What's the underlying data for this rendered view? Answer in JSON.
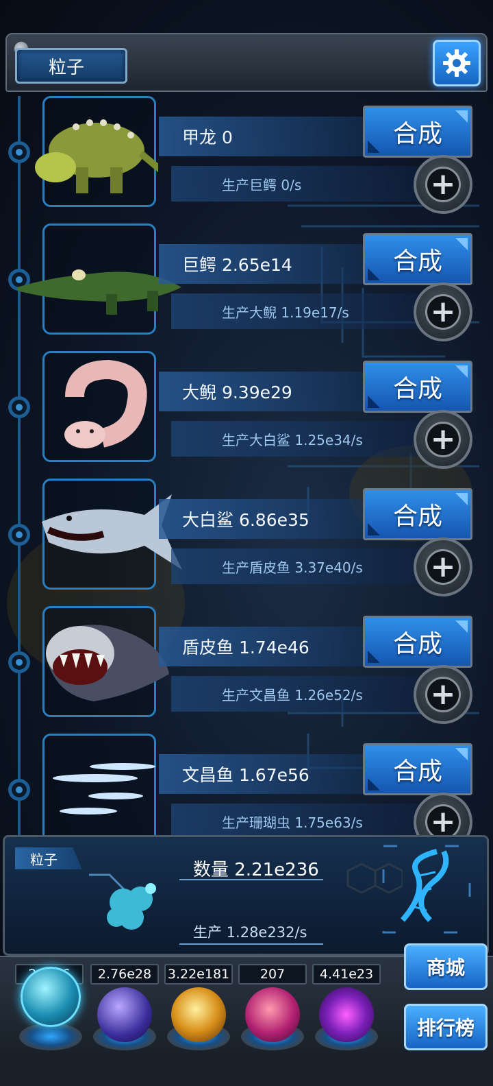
{
  "header": {
    "title": "粒子"
  },
  "creatures": [
    {
      "name": "甲龙 0",
      "production": "生产巨鳄 0/s",
      "combine_label": "合成",
      "icon": "ankylosaurus-icon"
    },
    {
      "name": "巨鳄 2.65e14",
      "production": "生产大鲵 1.19e17/s",
      "combine_label": "合成",
      "icon": "crocodile-icon"
    },
    {
      "name": "大鲵 9.39e29",
      "production": "生产大白鲨 1.25e34/s",
      "combine_label": "合成",
      "icon": "salamander-icon"
    },
    {
      "name": "大白鲨 6.86e35",
      "production": "生产盾皮鱼 3.37e40/s",
      "combine_label": "合成",
      "icon": "shark-icon"
    },
    {
      "name": "盾皮鱼 1.74e46",
      "production": "生产文昌鱼 1.26e52/s",
      "combine_label": "合成",
      "icon": "placoderm-icon"
    },
    {
      "name": "文昌鱼 1.67e56",
      "production": "生产珊瑚虫 1.75e63/s",
      "combine_label": "合成",
      "icon": "lancelet-icon"
    }
  ],
  "summary": {
    "tab_label": "粒子",
    "count": "数量 2.21e236",
    "production": "生产 1.28e232/s"
  },
  "resources": [
    {
      "value": "2.…26",
      "icon": "particle-orb-icon"
    },
    {
      "value": "2.76e28",
      "icon": "lightning-orb-icon"
    },
    {
      "value": "3.22e181",
      "icon": "fire-orb-icon"
    },
    {
      "value": "207",
      "icon": "brain-orb-icon"
    },
    {
      "value": "4.41e23",
      "icon": "vortex-orb-icon"
    }
  ],
  "side_buttons": {
    "shop": "商城",
    "ranking": "排行榜"
  },
  "colors": {
    "accent": "#2f8fe8",
    "panel": "#16304f",
    "text": "#e8f2ff"
  }
}
